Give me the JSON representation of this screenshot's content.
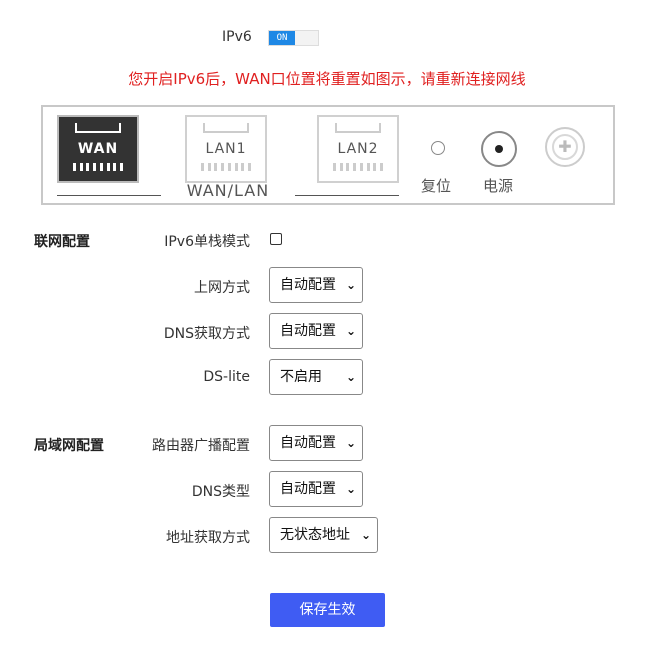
{
  "ipv6": {
    "label": "IPv6",
    "toggle_text": "ON"
  },
  "warning": "您开启IPv6后，WAN口位置将重置如图示，请重新连接网线",
  "router": {
    "wan": "WAN",
    "lan1": "LAN1",
    "lan2": "LAN2",
    "group_label": "WAN/LAN",
    "reset": "复位",
    "power": "电源"
  },
  "network": {
    "title": "联网配置",
    "single_stack_label": "IPv6单栈模式",
    "conn_label": "上网方式",
    "conn_value": "自动配置",
    "dns_label": "DNS获取方式",
    "dns_value": "自动配置",
    "dslite_label": "DS-lite",
    "dslite_value": "不启用"
  },
  "lan": {
    "title": "局域网配置",
    "ra_label": "路由器广播配置",
    "ra_value": "自动配置",
    "dns_type_label": "DNS类型",
    "dns_type_value": "自动配置",
    "addr_label": "地址获取方式",
    "addr_value": "无状态地址"
  },
  "save_label": "保存生效",
  "colors": {
    "accent": "#3f5cf3",
    "toggle": "#1e88e5",
    "warning": "#e02020"
  }
}
